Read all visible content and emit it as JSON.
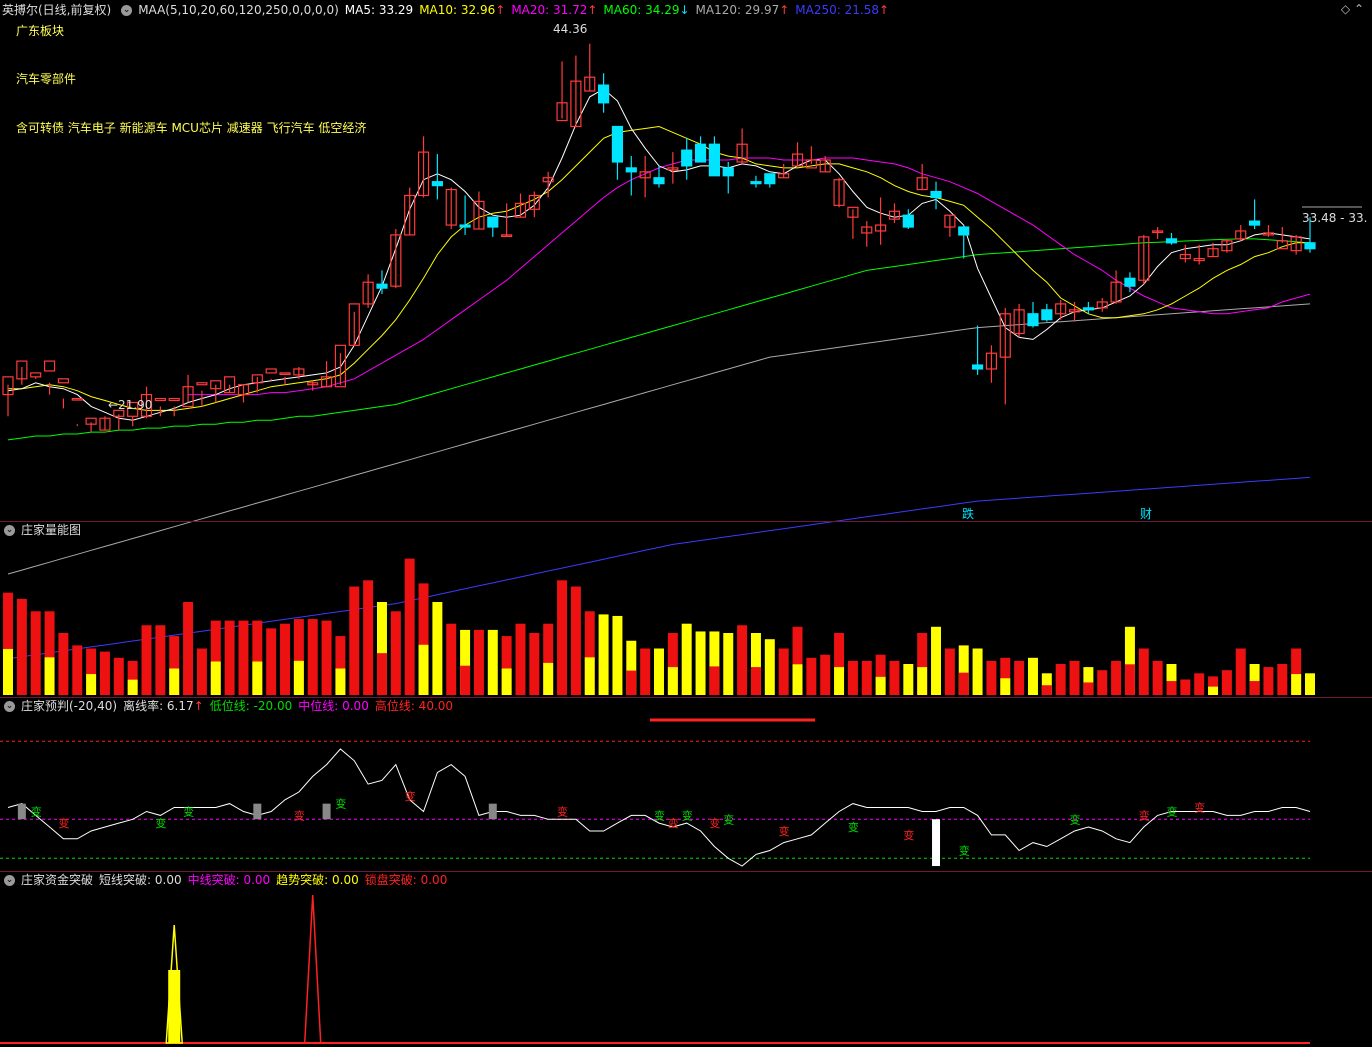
{
  "header": {
    "stock_name": "英搏尔(日线,前复权)",
    "maa_label": "MAA(5,10,20,60,120,250,0,0,0,0)",
    "ma5": "MA5: 33.29",
    "ma10": "MA10: 32.96",
    "ma20": "MA20: 31.72",
    "ma60": "MA60: 34.29",
    "ma120": "MA120: 29.97",
    "ma250": "MA250: 21.58",
    "ma10_arrow": "↑",
    "ma20_arrow": "↑",
    "ma60_arrow": "↓",
    "ma120_arrow": "↑",
    "ma250_arrow": "↑"
  },
  "concepts": {
    "region": "广东板块",
    "industry": "汽车零部件",
    "themes": "含可转债 汽车电子 新能源车 MCU芯片 减速器 飞行汽车 低空经济"
  },
  "annotations": {
    "high": "44.36",
    "low": "←21.90",
    "last": "33.48 - 33.",
    "marker_drop": "跌",
    "marker_fin": "财"
  },
  "panel2": {
    "title": "庄家量能图"
  },
  "panel3": {
    "title": "庄家预判(-20,40)",
    "deviation": "离线率: 6.17",
    "deviation_arrow": "↑",
    "low_line": "低位线: -20.00",
    "mid_line": "中位线: 0.00",
    "high_line": "高位线: 40.00",
    "change_glyph": "变"
  },
  "panel4": {
    "title": "庄家资金突破",
    "short": "短线突破: 0.00",
    "mid": "中线突破: 0.00",
    "trend": "趋势突破: 0.00",
    "lock": "锁盘突破: 0.00"
  },
  "colors": {
    "up": "#ff3b3b",
    "down": "#00e5ff",
    "ma5": "#ffffff",
    "ma10": "#ffff00",
    "ma20": "#ff00ff",
    "ma60": "#00ff00",
    "ma120": "#aaaaaa",
    "ma250": "#3b3bff",
    "vol_red": "#ee1111",
    "vol_yellow": "#ffff00"
  },
  "chart_data": [
    {
      "type": "candlestick",
      "ylim": [
        21.0,
        45.5
      ],
      "candles": [
        [
          26.6,
          27.5,
          27.1,
          25.5
        ],
        [
          27.4,
          28.3,
          28.0,
          27.1
        ],
        [
          27.5,
          27.7,
          27.5,
          27.4
        ],
        [
          27.8,
          28.3,
          27.2,
          26.6
        ],
        [
          27.2,
          27.4,
          26.4,
          25.9
        ],
        [
          26.4,
          26.4,
          25.1,
          25.0
        ],
        [
          25.1,
          25.4,
          25.2,
          24.7
        ],
        [
          24.8,
          25.4,
          25.5,
          24.8
        ],
        [
          25.5,
          25.8,
          25.6,
          24.8
        ],
        [
          25.5,
          26.2,
          25.5,
          25.0
        ],
        [
          25.5,
          26.6,
          27.0,
          25.4
        ],
        [
          26.3,
          26.4,
          26.0,
          25.5
        ],
        [
          26.3,
          26.4,
          26.0,
          25.5
        ],
        [
          26.0,
          27.0,
          27.6,
          26.2
        ],
        [
          27.1,
          27.2,
          26.8,
          26.0
        ],
        [
          26.9,
          27.3,
          27.1,
          26.2
        ],
        [
          26.7,
          27.5,
          27.1,
          26.7
        ],
        [
          26.6,
          27.1,
          27.1,
          26.2
        ],
        [
          27.2,
          27.6,
          27.5,
          26.7
        ],
        [
          27.7,
          27.9,
          27.4,
          27.3
        ],
        [
          27.7,
          27.7,
          27.5,
          27.1
        ],
        [
          27.6,
          27.9,
          28.0,
          27.4
        ],
        [
          27.1,
          27.2,
          27.3,
          26.8
        ],
        [
          27.0,
          27.5,
          28.3,
          27.0
        ],
        [
          27.0,
          29.1,
          28.7,
          27.1
        ],
        [
          29.1,
          31.2,
          30.8,
          29.1
        ],
        [
          31.2,
          32.3,
          32.7,
          31.0
        ],
        [
          32.2,
          32.0,
          32.9,
          31.7
        ],
        [
          32.1,
          34.7,
          35.0,
          32.0
        ],
        [
          34.7,
          36.7,
          37.1,
          34.7
        ],
        [
          36.7,
          38.9,
          39.7,
          36.6
        ],
        [
          37.4,
          37.2,
          38.8,
          36.5
        ],
        [
          35.2,
          37.0,
          37.1,
          35.0
        ],
        [
          35.2,
          35.1,
          36.7,
          34.7
        ],
        [
          35.0,
          36.4,
          36.9,
          35.0
        ],
        [
          35.6,
          35.1,
          35.5,
          34.6
        ],
        [
          34.7,
          34.7,
          36.3,
          34.6
        ],
        [
          35.6,
          36.3,
          36.8,
          35.6
        ],
        [
          36.0,
          36.7,
          36.9,
          35.6
        ],
        [
          37.4,
          37.6,
          37.9,
          36.6
        ],
        [
          40.5,
          41.4,
          43.5,
          40.6
        ],
        [
          40.2,
          42.5,
          43.8,
          40.2
        ],
        [
          42.0,
          42.7,
          44.4,
          42.0
        ],
        [
          42.3,
          41.4,
          42.9,
          40.9
        ],
        [
          40.2,
          38.4,
          40.0,
          37.5
        ],
        [
          38.1,
          37.9,
          38.7,
          36.7
        ],
        [
          37.6,
          37.9,
          38.7,
          36.6
        ],
        [
          37.6,
          37.3,
          38.2,
          37.1
        ],
        [
          38.0,
          38.1,
          38.9,
          37.3
        ],
        [
          39.0,
          38.2,
          39.6,
          37.5
        ],
        [
          39.3,
          38.4,
          39.7,
          38.4
        ],
        [
          39.3,
          37.7,
          39.7,
          37.7
        ],
        [
          38.1,
          37.7,
          38.4,
          36.8
        ],
        [
          38.4,
          39.3,
          40.1,
          38.3
        ],
        [
          37.4,
          37.3,
          37.7,
          37.1
        ],
        [
          37.8,
          37.3,
          37.6,
          37.1
        ],
        [
          37.6,
          37.8,
          38.3,
          37.6
        ],
        [
          38.2,
          38.8,
          39.4,
          38.2
        ],
        [
          38.1,
          38.5,
          39.2,
          38.3
        ],
        [
          37.9,
          38.5,
          38.7,
          37.9
        ],
        [
          36.2,
          37.5,
          37.6,
          36.1
        ],
        [
          35.6,
          36.1,
          36.0,
          34.5
        ],
        [
          34.8,
          35.1,
          35.4,
          34.1
        ],
        [
          34.9,
          35.2,
          36.6,
          34.2
        ],
        [
          35.5,
          35.9,
          36.3,
          35.3
        ],
        [
          35.7,
          35.1,
          36.0,
          35.0
        ],
        [
          37.0,
          37.6,
          38.3,
          37.0
        ],
        [
          36.9,
          36.6,
          37.4,
          36.0
        ],
        [
          35.1,
          35.7,
          35.7,
          34.6
        ],
        [
          35.1,
          34.7,
          34.7,
          33.5
        ],
        [
          28.1,
          27.9,
          30.1,
          27.6
        ],
        [
          27.9,
          28.7,
          29.1,
          27.2
        ],
        [
          28.5,
          30.7,
          31.0,
          26.1
        ],
        [
          29.7,
          30.9,
          31.2,
          29.5
        ],
        [
          30.7,
          30.1,
          31.3,
          30.0
        ],
        [
          30.9,
          30.4,
          31.2,
          30.3
        ],
        [
          30.7,
          31.2,
          31.4,
          30.4
        ],
        [
          30.8,
          30.9,
          31.3,
          30.3
        ],
        [
          31.0,
          30.9,
          31.3,
          30.7
        ],
        [
          31.0,
          31.3,
          31.5,
          30.8
        ],
        [
          31.3,
          32.3,
          32.9,
          31.2
        ],
        [
          32.5,
          32.1,
          32.8,
          31.8
        ],
        [
          32.4,
          34.6,
          34.7,
          32.2
        ],
        [
          34.9,
          34.9,
          35.1,
          34.5
        ],
        [
          34.5,
          34.3,
          34.8,
          34.2
        ],
        [
          33.5,
          33.7,
          34.2,
          33.3
        ],
        [
          33.4,
          33.5,
          34.2,
          33.2
        ],
        [
          33.6,
          34.0,
          34.3,
          33.6
        ],
        [
          33.9,
          34.4,
          34.5,
          33.8
        ],
        [
          34.5,
          34.9,
          35.2,
          34.4
        ],
        [
          35.4,
          35.2,
          36.5,
          35.0
        ],
        [
          34.7,
          34.8,
          35.2,
          34.6
        ],
        [
          34.0,
          34.4,
          35.1,
          34.3
        ],
        [
          33.9,
          34.6,
          34.7,
          33.7
        ],
        [
          34.3,
          34.0,
          35.6,
          33.8
        ]
      ],
      "ma5": [
        26.8,
        26.9,
        27.2,
        27.0,
        26.9,
        26.6,
        26.0,
        25.7,
        25.4,
        25.3,
        25.5,
        25.7,
        25.9,
        26.2,
        26.4,
        26.6,
        26.9,
        27.1,
        27.2,
        27.3,
        27.4,
        27.5,
        27.6,
        27.7,
        28.0,
        29.1,
        30.6,
        32.1,
        34.0,
        36.0,
        37.5,
        37.8,
        37.5,
        36.9,
        36.1,
        35.7,
        35.6,
        35.7,
        36.2,
        37.1,
        38.6,
        40.3,
        41.7,
        42.1,
        41.5,
        40.1,
        39.1,
        38.2,
        37.9,
        38.0,
        38.2,
        38.2,
        38.1,
        38.3,
        38.2,
        37.9,
        37.8,
        38.2,
        38.5,
        38.5,
        37.8,
        36.9,
        36.1,
        35.8,
        35.6,
        35.7,
        36.3,
        36.5,
        35.9,
        35.2,
        33.0,
        31.5,
        30.0,
        29.5,
        29.4,
        29.9,
        30.5,
        30.8,
        30.9,
        31.0,
        31.3,
        31.6,
        32.2,
        33.1,
        33.8,
        34.0,
        34.1,
        34.2,
        34.2,
        34.4,
        34.7,
        34.8,
        34.7,
        34.6,
        34.5
      ],
      "ma10": [
        26.9,
        26.9,
        27.0,
        27.1,
        27.0,
        26.8,
        26.5,
        26.3,
        26.1,
        25.9,
        25.8,
        25.8,
        25.8,
        25.9,
        26.0,
        26.2,
        26.4,
        26.6,
        26.8,
        27.0,
        27.1,
        27.2,
        27.3,
        27.4,
        27.6,
        28.2,
        28.9,
        29.6,
        30.4,
        31.4,
        32.5,
        33.7,
        34.6,
        35.2,
        35.6,
        35.8,
        35.9,
        36.2,
        36.5,
        36.9,
        37.5,
        38.2,
        38.9,
        39.6,
        39.9,
        40.0,
        40.1,
        40.2,
        39.9,
        39.6,
        39.3,
        38.9,
        38.7,
        38.6,
        38.3,
        38.2,
        38.1,
        38.1,
        38.2,
        38.3,
        38.3,
        38.1,
        37.9,
        37.6,
        37.2,
        36.9,
        36.7,
        36.6,
        36.4,
        36.2,
        35.6,
        35.0,
        34.3,
        33.6,
        32.9,
        32.3,
        31.5,
        31.1,
        30.7,
        30.5,
        30.5,
        30.6,
        30.7,
        30.9,
        31.2,
        31.6,
        32.0,
        32.5,
        32.9,
        33.2,
        33.6,
        33.8,
        34.1,
        34.3,
        34.3
      ],
      "ma20": [
        null,
        null,
        null,
        null,
        null,
        null,
        null,
        null,
        null,
        null,
        null,
        null,
        null,
        26.6,
        26.6,
        26.6,
        26.6,
        26.6,
        26.6,
        26.7,
        26.7,
        26.8,
        26.9,
        27.0,
        27.2,
        27.4,
        27.8,
        28.2,
        28.6,
        29.0,
        29.4,
        29.9,
        30.4,
        30.9,
        31.4,
        31.9,
        32.4,
        33.0,
        33.6,
        34.2,
        34.8,
        35.4,
        36.0,
        36.6,
        37.1,
        37.5,
        37.8,
        38.1,
        38.3,
        38.5,
        38.5,
        38.5,
        38.5,
        38.6,
        38.6,
        38.6,
        38.5,
        38.5,
        38.5,
        38.6,
        38.6,
        38.6,
        38.5,
        38.4,
        38.3,
        38.1,
        37.8,
        37.6,
        37.4,
        37.1,
        36.8,
        36.4,
        36.0,
        35.6,
        35.2,
        34.7,
        34.2,
        33.7,
        33.3,
        32.9,
        32.4,
        32.0,
        31.6,
        31.3,
        31.0,
        30.9,
        30.8,
        30.7,
        30.7,
        30.8,
        30.9,
        31.0,
        31.3,
        31.5,
        31.7
      ],
      "ma60": [
        24.3,
        24.4,
        24.5,
        24.5,
        24.6,
        24.6,
        24.7,
        24.7,
        24.8,
        24.8,
        24.9,
        24.9,
        25.0,
        25.0,
        25.1,
        25.1,
        25.2,
        25.2,
        25.3,
        25.3,
        25.4,
        25.5,
        25.5,
        25.6,
        25.7,
        25.8,
        25.9,
        26.0,
        26.1,
        26.3,
        26.5,
        26.7,
        26.9,
        27.1,
        27.3,
        27.5,
        27.7,
        27.9,
        28.1,
        28.3,
        28.5,
        28.7,
        28.9,
        29.1,
        29.3,
        29.5,
        29.7,
        29.9,
        30.1,
        30.3,
        30.5,
        30.7,
        30.9,
        31.1,
        31.3,
        31.5,
        31.7,
        31.9,
        32.1,
        32.3,
        32.5,
        32.7,
        32.9,
        33.0,
        33.1,
        33.2,
        33.3,
        33.4,
        33.5,
        33.6,
        33.7,
        33.75,
        33.8,
        33.85,
        33.9,
        33.95,
        34.0,
        34.05,
        34.1,
        34.15,
        34.2,
        34.25,
        34.3,
        34.33,
        34.36,
        34.39,
        34.42,
        34.45,
        34.48,
        34.5,
        34.5,
        34.45,
        34.4,
        34.35,
        34.29
      ],
      "ma120": [
        17.5,
        17.7,
        17.9,
        18.1,
        18.3,
        18.5,
        18.7,
        18.9,
        19.1,
        19.3,
        19.5,
        19.7,
        19.9,
        20.1,
        20.3,
        20.5,
        20.7,
        20.9,
        21.1,
        21.3,
        21.5,
        21.7,
        21.9,
        22.1,
        22.3,
        22.5,
        22.7,
        22.9,
        23.1,
        23.3,
        23.5,
        23.7,
        23.9,
        24.1,
        24.3,
        24.5,
        24.7,
        24.9,
        25.1,
        25.3,
        25.5,
        25.7,
        25.9,
        26.1,
        26.3,
        26.5,
        26.7,
        26.9,
        27.1,
        27.3,
        27.5,
        27.7,
        27.9,
        28.1,
        28.3,
        28.5,
        28.6,
        28.7,
        28.8,
        28.9,
        29.0,
        29.1,
        29.2,
        29.3,
        29.4,
        29.5,
        29.6,
        29.7,
        29.8,
        29.9,
        30.0,
        30.05,
        30.1,
        30.15,
        30.2,
        30.25,
        30.3,
        30.35,
        30.4,
        30.45,
        30.5,
        30.55,
        30.6,
        30.65,
        30.7,
        30.75,
        30.8,
        30.85,
        30.9,
        30.95,
        31.0,
        31.05,
        31.1,
        31.15,
        31.2
      ],
      "ma250": [
        13.2,
        13.3,
        13.4,
        13.5,
        13.6,
        13.7,
        13.8,
        13.9,
        14.0,
        14.1,
        14.2,
        14.3,
        14.4,
        14.5,
        14.6,
        14.7,
        14.8,
        14.9,
        15.0,
        15.1,
        15.2,
        15.3,
        15.4,
        15.5,
        15.6,
        15.7,
        15.8,
        15.9,
        16.0,
        16.15,
        16.3,
        16.45,
        16.6,
        16.75,
        16.9,
        17.05,
        17.2,
        17.35,
        17.5,
        17.65,
        17.8,
        17.95,
        18.1,
        18.25,
        18.4,
        18.55,
        18.7,
        18.85,
        19.0,
        19.1,
        19.2,
        19.3,
        19.4,
        19.5,
        19.6,
        19.7,
        19.8,
        19.9,
        20.0,
        20.1,
        20.2,
        20.3,
        20.4,
        20.5,
        20.6,
        20.7,
        20.8,
        20.9,
        21.0,
        21.1,
        21.2,
        21.25,
        21.3,
        21.35,
        21.4,
        21.45,
        21.5,
        21.55,
        21.6,
        21.65,
        21.7,
        21.75,
        21.8,
        21.85,
        21.9,
        21.95,
        22.0,
        22.05,
        22.1,
        22.15,
        22.2,
        22.25,
        22.3,
        22.35,
        22.4
      ]
    },
    {
      "type": "bar",
      "name": "volume",
      "ylim": [
        0,
        100
      ],
      "red": [
        66,
        62,
        54,
        54,
        0,
        0,
        0,
        0,
        0,
        0,
        0,
        45,
        45,
        60,
        0,
        48,
        48,
        48,
        48,
        43,
        46,
        49,
        49,
        48,
        38,
        70,
        74,
        60,
        54,
        88,
        72,
        60,
        46,
        42,
        42,
        42,
        38,
        46,
        40,
        46,
        74,
        70,
        54,
        52,
        51,
        0,
        0,
        0,
        0,
        0,
        41,
        41,
        40,
        45,
        0,
        0,
        0,
        0,
        0,
        0,
        0,
        22,
        0,
        0,
        0,
        0,
        0,
        0,
        0,
        0,
        0,
        0,
        0,
        0,
        0,
        0,
        0,
        0,
        0,
        0,
        0,
        0,
        0,
        0,
        0,
        0,
        0,
        0,
        0,
        0,
        0,
        0,
        0,
        0,
        0,
        0,
        0,
        0,
        0,
        0,
        0,
        0,
        0,
        0,
        0,
        0,
        0,
        0,
        0,
        0,
        0,
        0,
        0,
        0,
        0,
        0,
        0,
        0,
        0,
        0,
        0,
        0,
        0,
        0,
        0,
        0,
        0,
        0,
        0,
        0,
        0,
        0,
        0,
        0,
        0,
        0,
        0,
        0,
        0,
        0
      ],
      "yellow": []
    },
    {
      "type": "line",
      "name": "庄家预判",
      "ylim": [
        -25,
        55
      ],
      "low_line": -20,
      "mid_line": 0,
      "high_line": 40
    },
    {
      "type": "area",
      "name": "庄家资金突破",
      "ylim": [
        0,
        100
      ]
    }
  ]
}
